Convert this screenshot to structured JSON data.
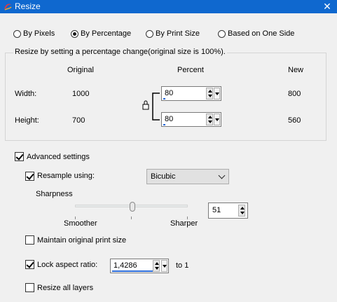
{
  "window": {
    "title": "Resize",
    "close_glyph": "✕"
  },
  "modes": [
    {
      "label": "By Pixels",
      "selected": false
    },
    {
      "label": "By Percentage",
      "selected": true
    },
    {
      "label": "By Print Size",
      "selected": false
    },
    {
      "label": "Based on One Side",
      "selected": false
    }
  ],
  "group": {
    "title": "Resize by setting a percentage change(original size is 100%).",
    "headers": {
      "original": "Original",
      "percent": "Percent",
      "new": "New"
    },
    "width": {
      "label": "Width:",
      "original": "1000",
      "percent": "80",
      "new": "800"
    },
    "height": {
      "label": "Height:",
      "original": "700",
      "percent": "80",
      "new": "560"
    }
  },
  "advanced": {
    "label": "Advanced settings",
    "checked": true,
    "resample": {
      "label": "Resample using:",
      "checked": true,
      "method": "Bicubic"
    },
    "sharpness": {
      "label": "Sharpness",
      "min_label": "Smoother",
      "max_label": "Sharper",
      "value": "51",
      "level": 0.51
    },
    "maintain_print": {
      "label": "Maintain original print size",
      "checked": false
    },
    "lock_aspect": {
      "label": "Lock aspect ratio:",
      "checked": true,
      "value": "1,4286",
      "suffix": "to 1"
    },
    "resize_layers": {
      "label": "Resize all layers",
      "checked": false
    }
  },
  "colors": {
    "titlebar": "#0f68cf",
    "accent": "#2a6ad8"
  },
  "icons": {
    "app": "app-logo-icon",
    "lock": "lock-icon",
    "close": "close-icon"
  }
}
